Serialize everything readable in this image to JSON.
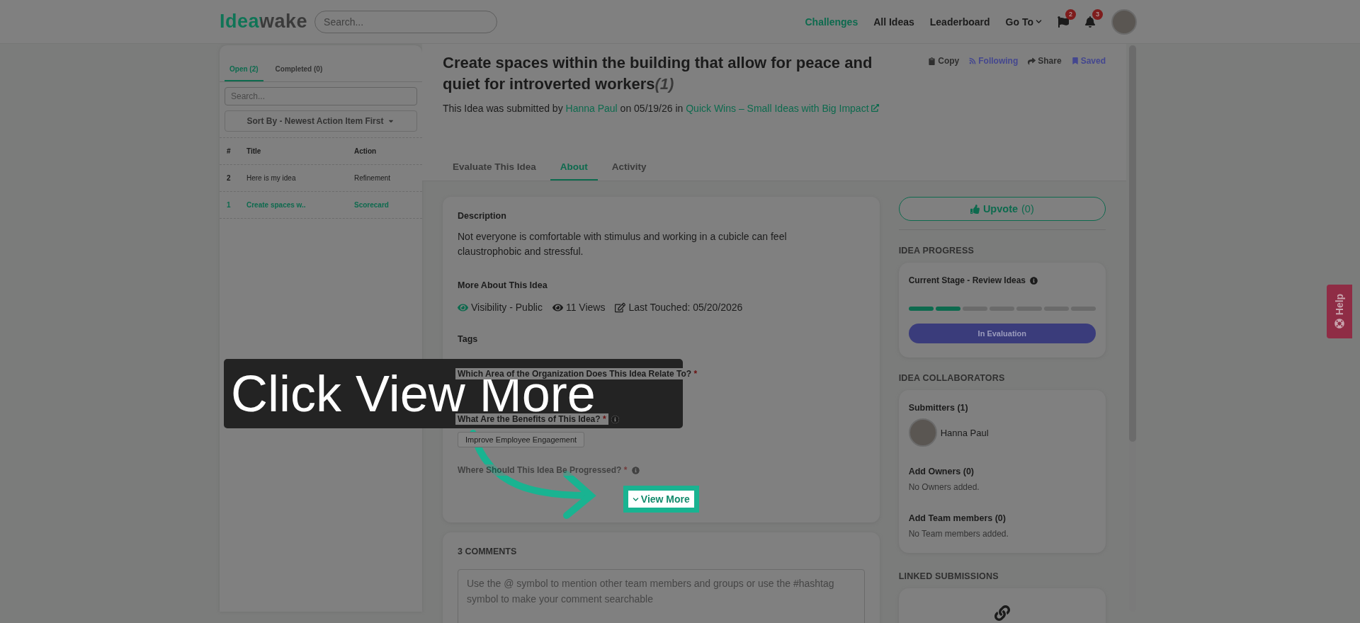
{
  "header": {
    "logo": "Ideawake",
    "search_placeholder": "Search...",
    "nav": [
      {
        "label": "Challenges",
        "selected": true
      },
      {
        "label": "All Ideas",
        "selected": false
      },
      {
        "label": "Leaderboard",
        "selected": false
      },
      {
        "label": "Go To",
        "selected": false
      }
    ],
    "flag_count": "2",
    "bell_count": "3"
  },
  "sidebar": {
    "tabs": [
      {
        "label": "Open (2)",
        "selected": true
      },
      {
        "label": "Completed (0)",
        "selected": false
      }
    ],
    "search_placeholder": "Search...",
    "sort": "Sort By - Newest Action Item First",
    "columns": [
      "#",
      "Title",
      "Action"
    ],
    "rows": [
      {
        "cells": [
          "2",
          "Here is my idea",
          "Refinement"
        ],
        "selected": false
      },
      {
        "cells": [
          "1",
          "Create spaces w..",
          "Scorecard"
        ],
        "selected": true
      }
    ]
  },
  "idea": {
    "title": "Create spaces within the building that allow for peace and quiet for introverted workers",
    "count": "(1)",
    "actions": [
      {
        "kind": "copy",
        "label": "Copy",
        "on": false
      },
      {
        "kind": "following",
        "label": "Following",
        "on": true
      },
      {
        "kind": "share",
        "label": "Share",
        "on": false
      },
      {
        "kind": "saved",
        "label": "Saved",
        "on": true
      }
    ],
    "submitted_prefix": "This Idea was submitted by",
    "author": "Hanna Paul",
    "submitted_middle": "on 05/19/26 in",
    "challenge": "Quick Wins – Small Ideas with Big Impact",
    "tabs": [
      {
        "label": "Evaluate This Idea",
        "selected": false
      },
      {
        "label": "About",
        "selected": true
      },
      {
        "label": "Activity",
        "selected": false
      }
    ]
  },
  "about": {
    "description_heading": "Description",
    "description": "Not everyone is comfortable with stimulus and working in a cubicle can feel claustrophobic and stressful.",
    "more_heading": "More About This Idea",
    "meta": [
      {
        "kind": "visibility",
        "text": "Visibility - Public"
      },
      {
        "kind": "views",
        "text": "11 Views"
      },
      {
        "kind": "touched",
        "text": "Last Touched: 05/20/2026"
      }
    ],
    "tags_heading": "Tags",
    "questions": [
      {
        "text": "Which Area of the Organization Does This Idea Relate To?",
        "required": "*",
        "info": false
      },
      {
        "text": "What Are the Benefits of This Idea?",
        "required": "*",
        "info": true,
        "answer": "Improve Employee Engagement"
      },
      {
        "text": "Where Should This Idea Be Progressed?",
        "required": "*",
        "info": true,
        "faded": true
      }
    ],
    "view_more": "View More"
  },
  "comments": {
    "heading": "3 COMMENTS",
    "placeholder": "Use the @ symbol to mention other team members and groups or use the #hashtag symbol to make your comment searchable"
  },
  "side": {
    "upvote_label": "Upvote",
    "upvote_count": "(0)",
    "progress_heading": "IDEA PROGRESS",
    "stage": "Current Stage - Review Ideas",
    "segments": [
      {
        "done": true
      },
      {
        "done": true
      },
      {
        "done": false
      },
      {
        "done": false
      },
      {
        "done": false
      },
      {
        "done": false
      },
      {
        "done": false
      }
    ],
    "status": "In Evaluation",
    "collab_heading": "IDEA COLLABORATORS",
    "submitters_heading": "Submitters (1)",
    "submitter": "Hanna Paul",
    "owners_heading": "Add Owners (0)",
    "owners_empty": "No Owners added.",
    "team_heading": "Add Team members (0)",
    "team_empty": "No Team members added.",
    "linked_heading": "LINKED SUBMISSIONS"
  },
  "help": "Help",
  "tutorial": {
    "caption": "Click View More"
  }
}
